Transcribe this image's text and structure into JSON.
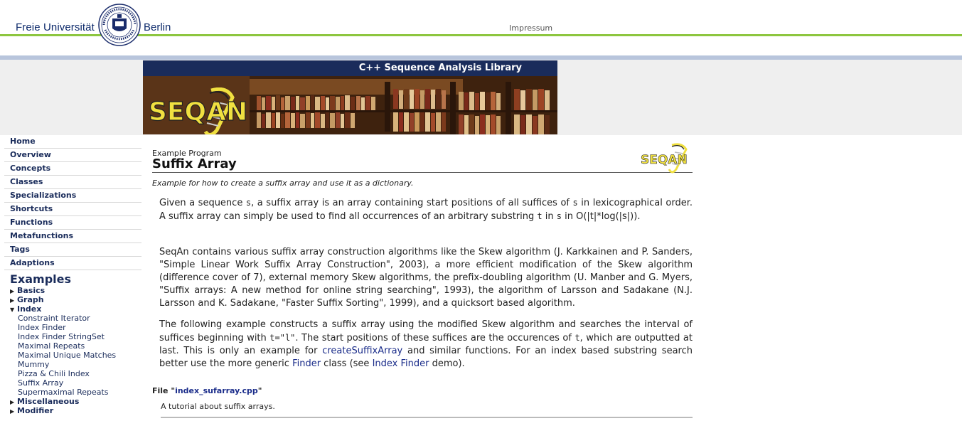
{
  "header": {
    "fu_left": "Freie Universität",
    "fu_right": "Berlin",
    "impressum": "Impressum"
  },
  "banner": {
    "title": "C++ Sequence Analysis Library",
    "logo_text": "SEQAN"
  },
  "sidebar": {
    "nav": [
      "Home",
      "Overview",
      "Concepts",
      "Classes",
      "Specializations",
      "Shortcuts",
      "Functions",
      "Metafunctions",
      "Tags",
      "Adaptions"
    ],
    "examples_heading": "Examples",
    "categories": [
      {
        "label": "Basics",
        "expanded": false
      },
      {
        "label": "Graph",
        "expanded": false
      },
      {
        "label": "Index",
        "expanded": true
      }
    ],
    "index_items": [
      "Constraint Iterator",
      "Index Finder",
      "Index Finder StringSet",
      "Maximal Repeats",
      "Maximal Unique Matches",
      "Mummy",
      "Pizza & Chili Index",
      "Suffix Array",
      "Supermaximal Repeats"
    ],
    "more_categories": [
      {
        "label": "Miscellaneous",
        "expanded": false
      },
      {
        "label": "Modifier",
        "expanded": false
      }
    ]
  },
  "main": {
    "example_label": "Example Program",
    "title": "Suffix Array",
    "logo_text": "SEQAN",
    "subtitle": "Example for how to create a suffix array and use it as a dictionary.",
    "p1": {
      "a": "Given a sequence ",
      "s1": "s",
      "b": ", a suffix array is an array containing start positions of all suffices of ",
      "s2": "s",
      "c": " in lexicographical order. A suffix array can simply be used to find all occurrences of an arbitrary substring ",
      "t": "t",
      "d": " in ",
      "s3": "s",
      "e": " in O(|t|*log(|s|))."
    },
    "p2": "SeqAn contains various suffix array construction algorithms like the Skew algorithm (J. Karkkainen and P. Sanders, \"Simple Linear Work Suffix Array Construction\", 2003), a more efficient modification of the Skew algorithm (difference cover of 7), external memory Skew algorithms, the prefix-doubling algorithm (U. Manber and G. Myers, \"Suffix arrays: A new method for online string searching\", 1993), the algorithm of Larsson and Sadakane (N.J. Larsson and K. Sadakane, \"Faster Suffix Sorting\", 1999), and a quicksort based algorithm.",
    "p3": {
      "a": "The following example constructs a suffix array using the modified Skew algorithm and searches the interval of suffices beginning with ",
      "code": "t=\"l\"",
      "b": ". The start positions of these suffices are the occurences of ",
      "t": "t",
      "c": ", which are outputted at last. This is only an example for ",
      "link1": "createSuffixArray",
      "d": " and similar functions. For an index based substring search better use the more generic ",
      "link2": "Finder",
      "e": " class (see ",
      "link3": "Index Finder",
      "f": " demo)."
    },
    "file_prefix": "File \"",
    "file_name": "index_sufarray.cpp",
    "file_suffix": "\"",
    "tutorial": "A tutorial about suffix arrays."
  }
}
